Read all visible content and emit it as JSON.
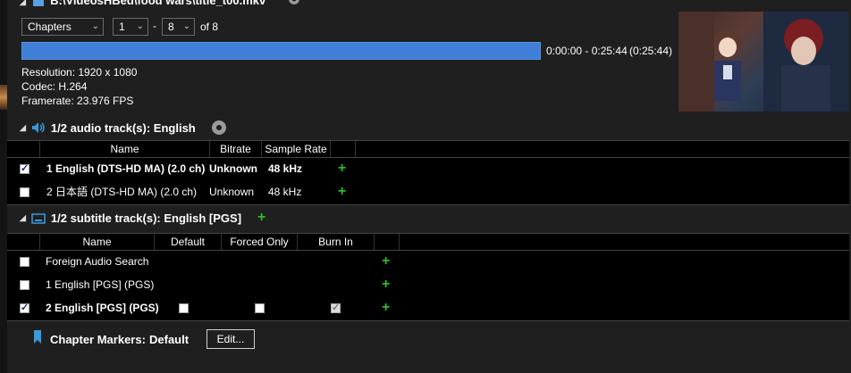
{
  "title": {
    "path": "B:\\VideosHBed\\food wars\\title_t00.mkv"
  },
  "range": {
    "mode": "Chapters",
    "start": "1",
    "separator": "-",
    "end": "8",
    "of_label": "of 8",
    "time_range": "0:00:00 - 0:25:44",
    "duration": "(0:25:44)"
  },
  "info": {
    "resolution": "Resolution: 1920 x 1080",
    "codec": "Codec: H.264",
    "framerate": "Framerate: 23.976 FPS"
  },
  "audio": {
    "header": "1/2 audio track(s): English",
    "columns": [
      "Name",
      "Bitrate",
      "Sample Rate"
    ],
    "rows": [
      {
        "checked": true,
        "name": "1 English (DTS-HD MA) (2.0 ch)",
        "bitrate": "Unknown",
        "sample_rate": "48 kHz"
      },
      {
        "checked": false,
        "name": "2 日本語 (DTS-HD MA) (2.0 ch)",
        "bitrate": "Unknown",
        "sample_rate": "48 kHz"
      }
    ]
  },
  "subtitles": {
    "header": "1/2 subtitle track(s): English [PGS]",
    "columns": [
      "Name",
      "Default",
      "Forced Only",
      "Burn In"
    ],
    "rows": [
      {
        "checked": false,
        "name": "Foreign Audio Search"
      },
      {
        "checked": false,
        "name": "1 English [PGS] (PGS)"
      },
      {
        "checked": true,
        "name": "2 English [PGS] (PGS)",
        "default": false,
        "forced_only": false,
        "burn_in": true
      }
    ]
  },
  "chapters": {
    "label": "Chapter Markers:",
    "value": "Default",
    "edit_label": "Edit..."
  },
  "colors": {
    "accent": "#3f7fd8",
    "plus": "#2fb82f",
    "background": "#1f1f1f",
    "table": "#000000"
  }
}
